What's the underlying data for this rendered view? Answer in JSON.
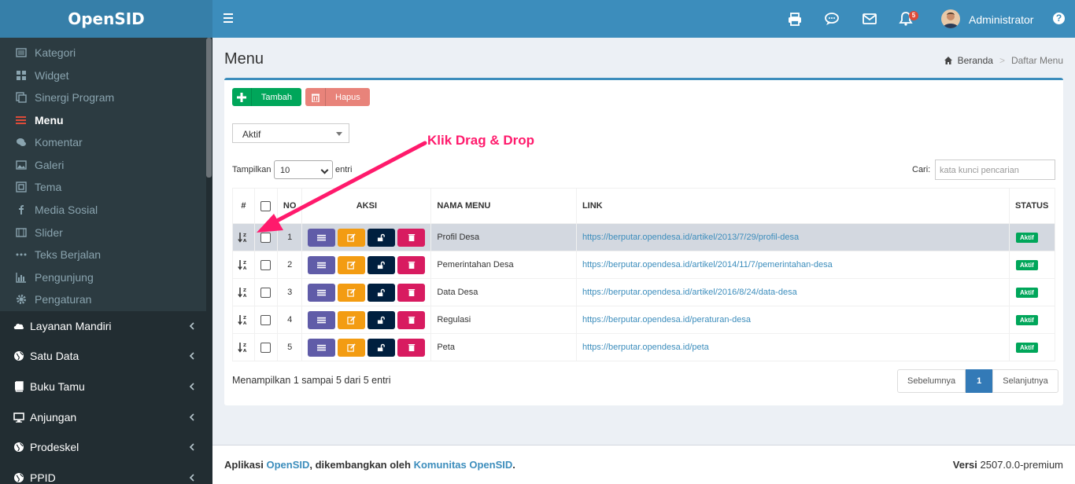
{
  "app": {
    "logo": "OpenSID"
  },
  "header": {
    "notif_count": "5",
    "user_name": "Administrator",
    "help": "?"
  },
  "sidebar": {
    "sub_items": [
      {
        "label": "Kategori",
        "icon": "list-icon"
      },
      {
        "label": "Widget",
        "icon": "widget-icon"
      },
      {
        "label": "Sinergi Program",
        "icon": "copy-icon"
      },
      {
        "label": "Menu",
        "icon": "bars-icon"
      },
      {
        "label": "Komentar",
        "icon": "comments-icon"
      },
      {
        "label": "Galeri",
        "icon": "image-icon"
      },
      {
        "label": "Tema",
        "icon": "frame-icon"
      },
      {
        "label": "Media Sosial",
        "icon": "facebook-icon"
      },
      {
        "label": "Slider",
        "icon": "film-icon"
      },
      {
        "label": "Teks Berjalan",
        "icon": "ellipsis-icon"
      },
      {
        "label": "Pengunjung",
        "icon": "chart-icon"
      },
      {
        "label": "Pengaturan",
        "icon": "gear-icon"
      }
    ],
    "main_items": [
      {
        "label": "Layanan Mandiri",
        "icon": "cloud-icon"
      },
      {
        "label": "Satu Data",
        "icon": "globe-icon"
      },
      {
        "label": "Buku Tamu",
        "icon": "book-icon"
      },
      {
        "label": "Anjungan",
        "icon": "desktop-icon"
      },
      {
        "label": "Prodeskel",
        "icon": "globe-icon"
      },
      {
        "label": "PPID",
        "icon": "globe-icon"
      }
    ]
  },
  "page": {
    "title": "Menu"
  },
  "breadcrumb": {
    "home": "Beranda",
    "current": "Daftar Menu"
  },
  "toolbar": {
    "add_label": "Tambah",
    "delete_label": "Hapus"
  },
  "filter": {
    "status_value": "Aktif"
  },
  "list": {
    "show_label": "Tampilkan",
    "page_length": "10",
    "entries_label": "entri",
    "search_label": "Cari:",
    "search_placeholder": "kata kunci pencarian"
  },
  "table": {
    "headers": {
      "hash": "#",
      "no": "NO",
      "actions": "AKSI",
      "name": "NAMA MENU",
      "link": "LINK",
      "status": "STATUS"
    },
    "rows": [
      {
        "no": "1",
        "name": "Profil Desa",
        "link": "https://berputar.opendesa.id/artikel/2013/7/29/profil-desa",
        "status": "Aktif"
      },
      {
        "no": "2",
        "name": "Pemerintahan Desa",
        "link": "https://berputar.opendesa.id/artikel/2014/11/7/pemerintahan-desa",
        "status": "Aktif"
      },
      {
        "no": "3",
        "name": "Data Desa",
        "link": "https://berputar.opendesa.id/artikel/2016/8/24/data-desa",
        "status": "Aktif"
      },
      {
        "no": "4",
        "name": "Regulasi",
        "link": "https://berputar.opendesa.id/peraturan-desa",
        "status": "Aktif"
      },
      {
        "no": "5",
        "name": "Peta",
        "link": "https://berputar.opendesa.id/peta",
        "status": "Aktif"
      }
    ]
  },
  "pagination": {
    "info": "Menampilkan 1 sampai 5 dari 5 entri",
    "prev": "Sebelumnya",
    "current": "1",
    "next": "Selanjutnya"
  },
  "annotation": {
    "text": "Klik Drag & Drop"
  },
  "footer": {
    "prefix": "Aplikasi ",
    "app_link": "OpenSID",
    "middle": ", dikembangkan oleh ",
    "community_link": "Komunitas OpenSID",
    "suffix": ".",
    "version_label": "Versi",
    "version": "2507.0.0-premium"
  },
  "colors": {
    "primary": "#3c8dbc",
    "sidebar": "#222d32",
    "success": "#00a65a",
    "danger": "#dd4b39",
    "annotation": "#ff1a6c"
  }
}
